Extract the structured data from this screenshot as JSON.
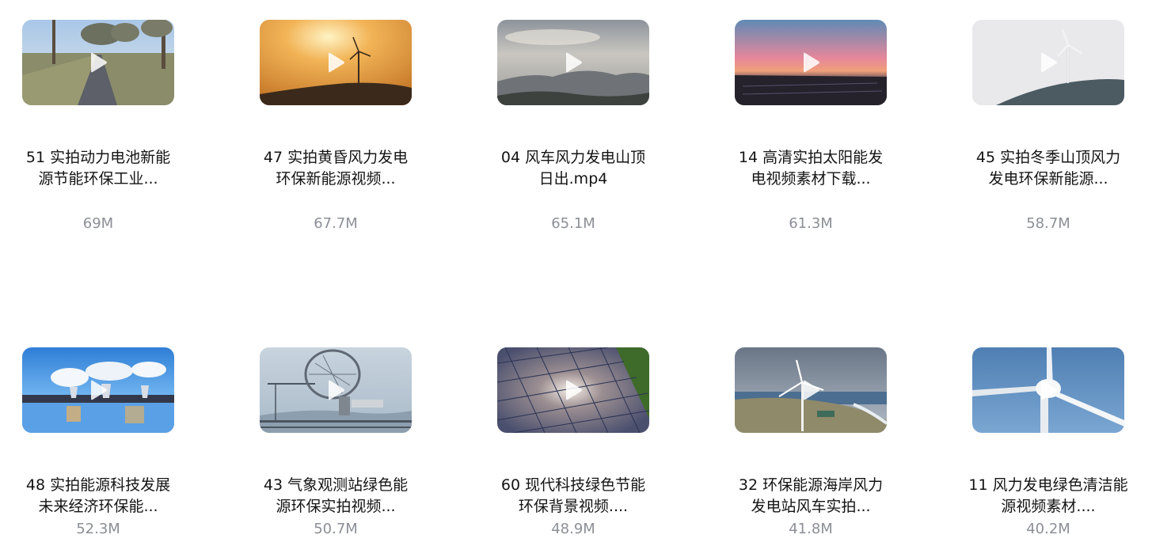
{
  "files": [
    {
      "name": "51 实拍动力电池新能\n源节能环保工业...",
      "size": "69M",
      "scene": "road-trees-icon",
      "play_icon": "play-icon"
    },
    {
      "name": "47 实拍黄昏风力发电\n环保新能源视频...",
      "size": "67.7M",
      "scene": "sunset-wind-turbine-icon",
      "play_icon": "play-icon"
    },
    {
      "name": "04 风车风力发电山顶\n日出.mp4",
      "size": "65.1M",
      "scene": "misty-mountain-sunrise-icon",
      "play_icon": "play-icon"
    },
    {
      "name": "14 高清实拍太阳能发\n电视频素材下载...",
      "size": "61.3M",
      "scene": "dusk-solar-field-icon",
      "play_icon": "play-icon"
    },
    {
      "name": "45 实拍冬季山顶风力\n发电环保新能源...",
      "size": "58.7M",
      "scene": "winter-hill-wind-turbine-icon",
      "play_icon": "play-icon"
    },
    {
      "name": "48 实拍能源科技发展\n未来经济环保能...",
      "size": "52.3M",
      "scene": "power-plant-reflection-icon",
      "play_icon": "play-icon"
    },
    {
      "name": "43 气象观测站绿色能\n源环保实拍视频...",
      "size": "50.7M",
      "scene": "weather-station-dish-icon",
      "play_icon": "play-icon"
    },
    {
      "name": "60 现代科技绿色节能\n环保背景视频....",
      "size": "48.9M",
      "scene": "solar-panel-closeup-icon",
      "play_icon": "play-icon"
    },
    {
      "name": "32 环保能源海岸风力\n发电站风车实拍...",
      "size": "41.8M",
      "scene": "coastal-wind-turbine-icon",
      "play_icon": "play-icon"
    },
    {
      "name": "11 风力发电绿色清洁能\n源视频素材....",
      "size": "40.2M",
      "scene": "turbine-hub-closeup-icon",
      "play_icon": "play-icon"
    }
  ]
}
